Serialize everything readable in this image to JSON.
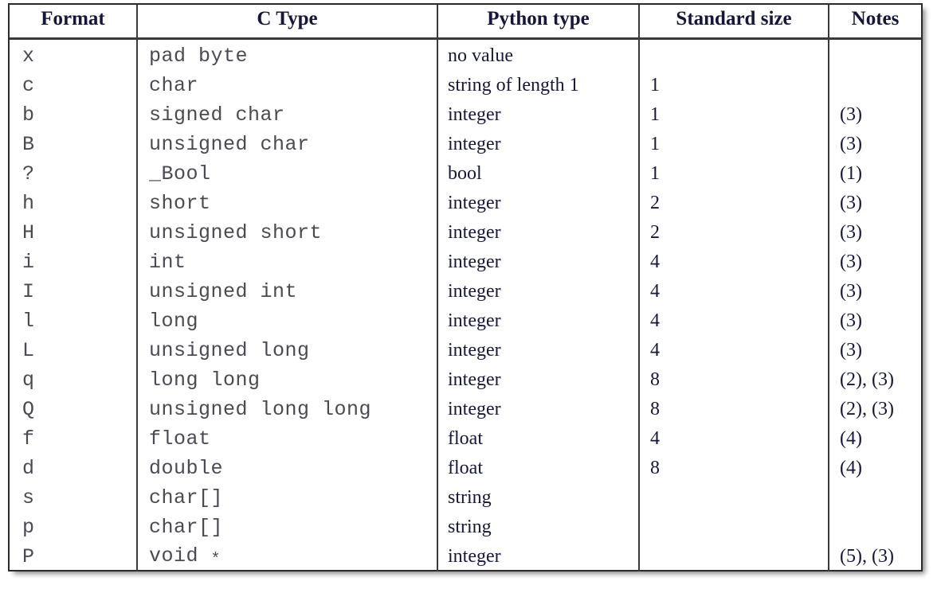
{
  "table": {
    "caption": "",
    "columns": [
      {
        "key": "format",
        "label": "Format"
      },
      {
        "key": "ctype",
        "label": "C Type"
      },
      {
        "key": "pytype",
        "label": "Python type"
      },
      {
        "key": "size",
        "label": "Standard size"
      },
      {
        "key": "notes",
        "label": "Notes"
      }
    ],
    "rows": [
      {
        "format": "x",
        "ctype": "pad byte",
        "pytype": "no value",
        "size": "",
        "notes": ""
      },
      {
        "format": "c",
        "ctype": "char",
        "pytype": "string of length 1",
        "size": "1",
        "notes": ""
      },
      {
        "format": "b",
        "ctype": "signed char",
        "pytype": "integer",
        "size": "1",
        "notes": "(3)"
      },
      {
        "format": "B",
        "ctype": "unsigned char",
        "pytype": "integer",
        "size": "1",
        "notes": "(3)"
      },
      {
        "format": "?",
        "ctype": "_Bool",
        "pytype": "bool",
        "size": "1",
        "notes": "(1)"
      },
      {
        "format": "h",
        "ctype": "short",
        "pytype": "integer",
        "size": "2",
        "notes": "(3)"
      },
      {
        "format": "H",
        "ctype": "unsigned short",
        "pytype": "integer",
        "size": "2",
        "notes": "(3)"
      },
      {
        "format": "i",
        "ctype": "int",
        "pytype": "integer",
        "size": "4",
        "notes": "(3)"
      },
      {
        "format": "I",
        "ctype": "unsigned int",
        "pytype": "integer",
        "size": "4",
        "notes": "(3)"
      },
      {
        "format": "l",
        "ctype": "long",
        "pytype": "integer",
        "size": "4",
        "notes": "(3)"
      },
      {
        "format": "L",
        "ctype": "unsigned long",
        "pytype": "integer",
        "size": "4",
        "notes": "(3)"
      },
      {
        "format": "q",
        "ctype": "long long",
        "pytype": "integer",
        "size": "8",
        "notes": "(2), (3)"
      },
      {
        "format": "Q",
        "ctype": "unsigned long long",
        "pytype": "integer",
        "size": "8",
        "notes": "(2), (3)"
      },
      {
        "format": "f",
        "ctype": "float",
        "pytype": "float",
        "size": "4",
        "notes": "(4)"
      },
      {
        "format": "d",
        "ctype": "double",
        "pytype": "float",
        "size": "8",
        "notes": "(4)"
      },
      {
        "format": "s",
        "ctype": "char[]",
        "pytype": "string",
        "size": "",
        "notes": ""
      },
      {
        "format": "p",
        "ctype": "char[]",
        "pytype": "string",
        "size": "",
        "notes": ""
      },
      {
        "format": "P",
        "ctype": "void *",
        "pytype": "integer",
        "size": "",
        "notes": "(5), (3)"
      }
    ]
  },
  "colors": {
    "border": "#3a3a3a",
    "outer_border": "#2b2b2b",
    "header_text": "#15163a",
    "mono_text": "#4a4a52",
    "serif_text": "#16173b",
    "background": "#ffffff"
  }
}
